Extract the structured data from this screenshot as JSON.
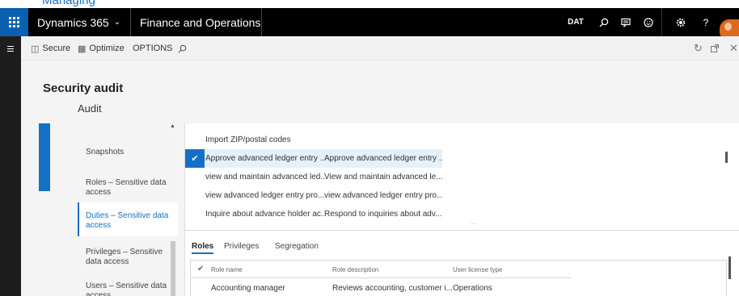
{
  "header": {
    "partial_text": "Managing",
    "app_name": "Dynamics 365",
    "module_name": "Finance and Operations",
    "company": "DAT",
    "icons": [
      "search-icon",
      "feedback-icon",
      "smiley-icon",
      "gear-icon",
      "help-icon",
      "user-avatar"
    ],
    "help_glyph": "?"
  },
  "actionbar": {
    "secure_label": "Secure",
    "optimize_label": "Optimize",
    "options_label": "OPTIONS"
  },
  "page": {
    "title": "Security audit",
    "subtitle": "Audit"
  },
  "nav": {
    "items": [
      {
        "label": "Snapshots"
      },
      {
        "label": "Roles – Sensitive data access"
      },
      {
        "label": "Duties – Sensitive data access",
        "selected": true
      },
      {
        "label": "Privileges – Sensitive data access"
      },
      {
        "label": "Users – Sensitive data access"
      }
    ]
  },
  "grid1": {
    "rows": [
      {
        "name": "Import ZIP/postal codes",
        "description": ""
      },
      {
        "name": "Approve advanced ledger entry ...",
        "description": "Approve advanced ledger entry ...",
        "selected": true
      },
      {
        "name": "view and maintain advanced led...",
        "description": "View and maintain advanced le..."
      },
      {
        "name": "view advanced ledger entry pro...",
        "description": "view advanced ledger entry pro..."
      },
      {
        "name": "Inquire about advance holder ac...",
        "description": "Respond to inquiries about adv..."
      }
    ],
    "more": "..."
  },
  "tabs": [
    "Roles",
    "Privileges",
    "Segregation"
  ],
  "grid2": {
    "columns": [
      "Role name",
      "Role description",
      "User license type"
    ],
    "rows": [
      {
        "role_name": "Accounting manager",
        "role_description": "Reviews accounting, customer i...",
        "license": "Operations"
      }
    ]
  }
}
